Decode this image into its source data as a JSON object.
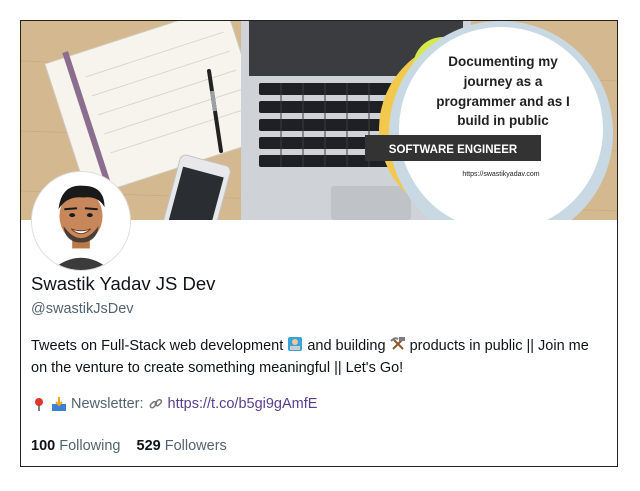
{
  "profile": {
    "name": "Swastik Yadav JS Dev",
    "handle": "@swastikJsDev",
    "bio_part1": "Tweets on Full-Stack web development",
    "bio_part2": "and building",
    "bio_part3": "products in public || Join me on the venture to create something meaningful || Let's Go!",
    "newsletter_label": "Newsletter:",
    "link": "https://t.co/b5gi9gAmfE",
    "following_count": "100",
    "following_label": "Following",
    "followers_count": "529",
    "followers_label": "Followers"
  },
  "banner": {
    "line1": "Documenting my",
    "line2": "journey as a",
    "line3": "programmer  and as I",
    "line4": "build  in public",
    "badge": "SOFTWARE ENGINEER",
    "url": "https://swastikyadav.com"
  },
  "colors": {
    "link": "#5b3d8f",
    "accent_yellow": "#f2c94c",
    "accent_green": "#d6e84a"
  }
}
